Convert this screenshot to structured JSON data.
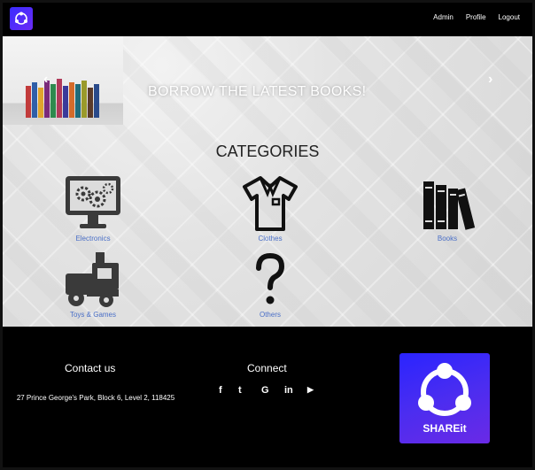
{
  "navbar": {
    "links": [
      "Admin",
      "Profile",
      "Logout"
    ]
  },
  "carousel": {
    "caption": "BORROW THE LATEST BOOKS!",
    "prev_icon": "chevron-left-icon",
    "next_icon": "chevron-right-icon"
  },
  "categories": {
    "title": "CATEGORIES",
    "items": [
      {
        "label": "Electronics",
        "icon": "monitor-gears-icon"
      },
      {
        "label": "Clothes",
        "icon": "shirt-icon"
      },
      {
        "label": "Books",
        "icon": "books-icon"
      },
      {
        "label": "Toys & Games",
        "icon": "toy-train-icon"
      },
      {
        "label": "Others",
        "icon": "question-mark-icon"
      }
    ]
  },
  "footer": {
    "contact_heading": "Contact us",
    "address": "27 Prince George's Park, Block 6, Level 2, 118425",
    "connect_heading": "Connect",
    "social_icons": [
      "facebook-icon",
      "twitter-icon",
      "google-icon",
      "linkedin-icon",
      "youtube-icon"
    ],
    "social_glyphs": [
      "f",
      "t",
      "G",
      "in",
      "▶"
    ],
    "app_name": "SHAREit"
  },
  "colors": {
    "brand_gradient_start": "#2a24ff",
    "brand_gradient_end": "#6a2ae6",
    "link": "#4a6fc7",
    "navbar_bg": "#000000"
  }
}
